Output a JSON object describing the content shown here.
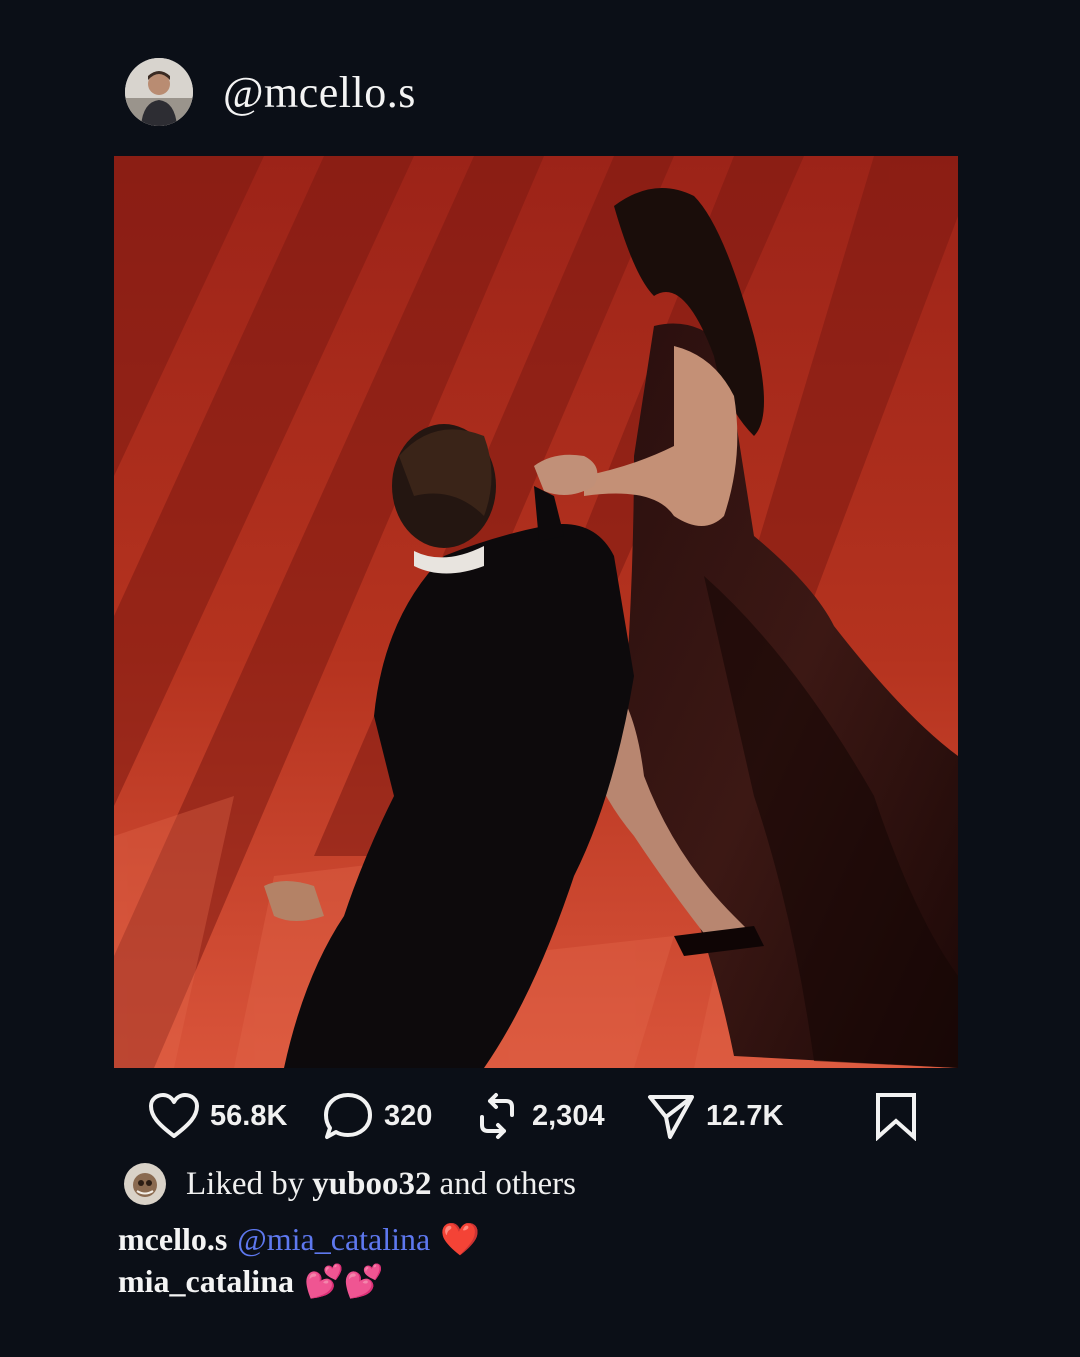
{
  "post": {
    "username": "@mcello.s"
  },
  "actions": {
    "likes": "56.8K",
    "comments": "320",
    "reposts": "2,304",
    "shares": "12.7K"
  },
  "liked_by": {
    "prefix": "Liked by",
    "user": "yuboo32",
    "suffix": "and others"
  },
  "comments": [
    {
      "user": "mcello.s",
      "mention": "@mia_catalina",
      "emoji": "❤️"
    },
    {
      "user": "mia_catalina",
      "emoji": "💕💕"
    }
  ],
  "colors": {
    "background": "#0b0f17",
    "carpet": "#b0281c",
    "mention": "#5e78ef",
    "text": "#f2f2f2"
  }
}
